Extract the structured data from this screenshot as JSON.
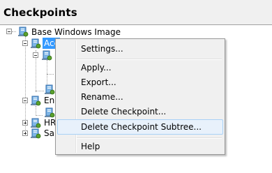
{
  "panel": {
    "title": "Checkpoints"
  },
  "tree": {
    "root": "Base Windows Image",
    "selected": "Acc",
    "engine": "Eng",
    "hr": "HR",
    "sales": "Sal"
  },
  "context_menu": {
    "items": [
      {
        "label": "Settings..."
      },
      {
        "label": "Apply..."
      },
      {
        "label": "Export..."
      },
      {
        "label": "Rename..."
      },
      {
        "label": "Delete Checkpoint..."
      },
      {
        "label": "Delete Checkpoint Subtree..."
      },
      {
        "label": "Help"
      }
    ],
    "highlighted": "Delete Checkpoint Subtree..."
  },
  "colors": {
    "selection": "#3399ff",
    "menu_highlight": "#e8f1fb"
  }
}
